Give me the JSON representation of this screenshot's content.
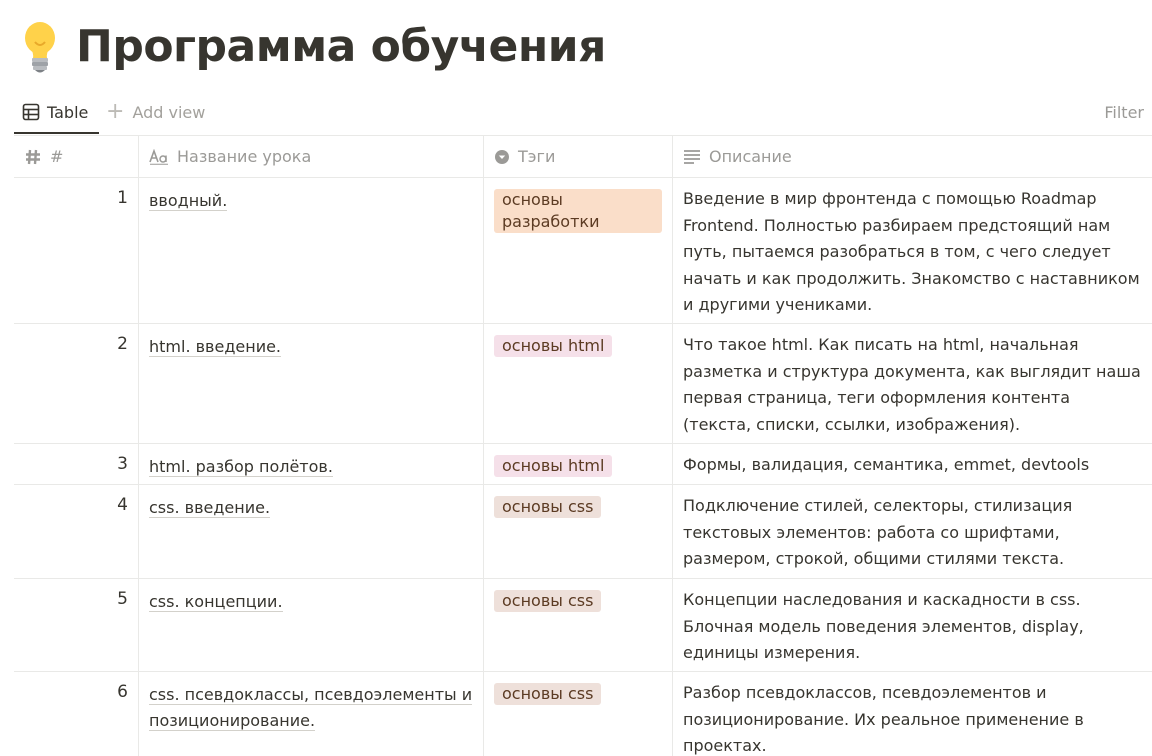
{
  "page": {
    "icon": "lightbulb-icon",
    "title": "Программа обучения"
  },
  "viewbar": {
    "table_tab_label": "Table",
    "add_view_label": "Add view",
    "filter_label": "Filter"
  },
  "columns": {
    "num": "#",
    "name": "Название урока",
    "tags": "Тэги",
    "desc": "Описание"
  },
  "tag_colors": {
    "основы разработки": "#fadec9",
    "основы html": "#f5e0e9",
    "основы css": "#eee0da"
  },
  "rows": [
    {
      "num": "1",
      "name": "вводный.",
      "tag": "основы разработки",
      "tag_color": "#fadec9",
      "desc": "Введение в мир фронтенда с помощью Roadmap Frontend. Полностью разбираем предстоящий нам путь, пытаемся разобраться в том, с чего следует начать и как продолжить. Знакомство с наставником и другими учениками."
    },
    {
      "num": "2",
      "name": "html. введение.",
      "tag": "основы html",
      "tag_color": "#f5e0e9",
      "desc": "Что такое html. Как писать на html, начальная разметка и структура документа, как выглядит наша первая страница, теги оформления контента (текста, списки, ссылки, изображения)."
    },
    {
      "num": "3",
      "name": "html. разбор полётов.",
      "tag": "основы html",
      "tag_color": "#f5e0e9",
      "desc": "Формы, валидация, семантика, emmet, devtools"
    },
    {
      "num": "4",
      "name": "css. введение.",
      "tag": "основы css",
      "tag_color": "#eee0da",
      "desc": "Подключение стилей, селекторы, стилизация текстовых элементов: работа со шрифтами, размером, строкой, общими стилями текста."
    },
    {
      "num": "5",
      "name": "css. концепции.",
      "tag": "основы css",
      "tag_color": "#eee0da",
      "desc": "Концепции наследования и каскадности в css. Блочная модель поведения элементов, display, единицы измерения."
    },
    {
      "num": "6",
      "name": "css. псевдоклассы, псевдоэлементы и позиционирование.",
      "tag": "основы css",
      "tag_color": "#eee0da",
      "desc": "Разбор псевдоклассов, псевдоэлементов и позиционирование. Их реальное применение в проектах."
    }
  ]
}
